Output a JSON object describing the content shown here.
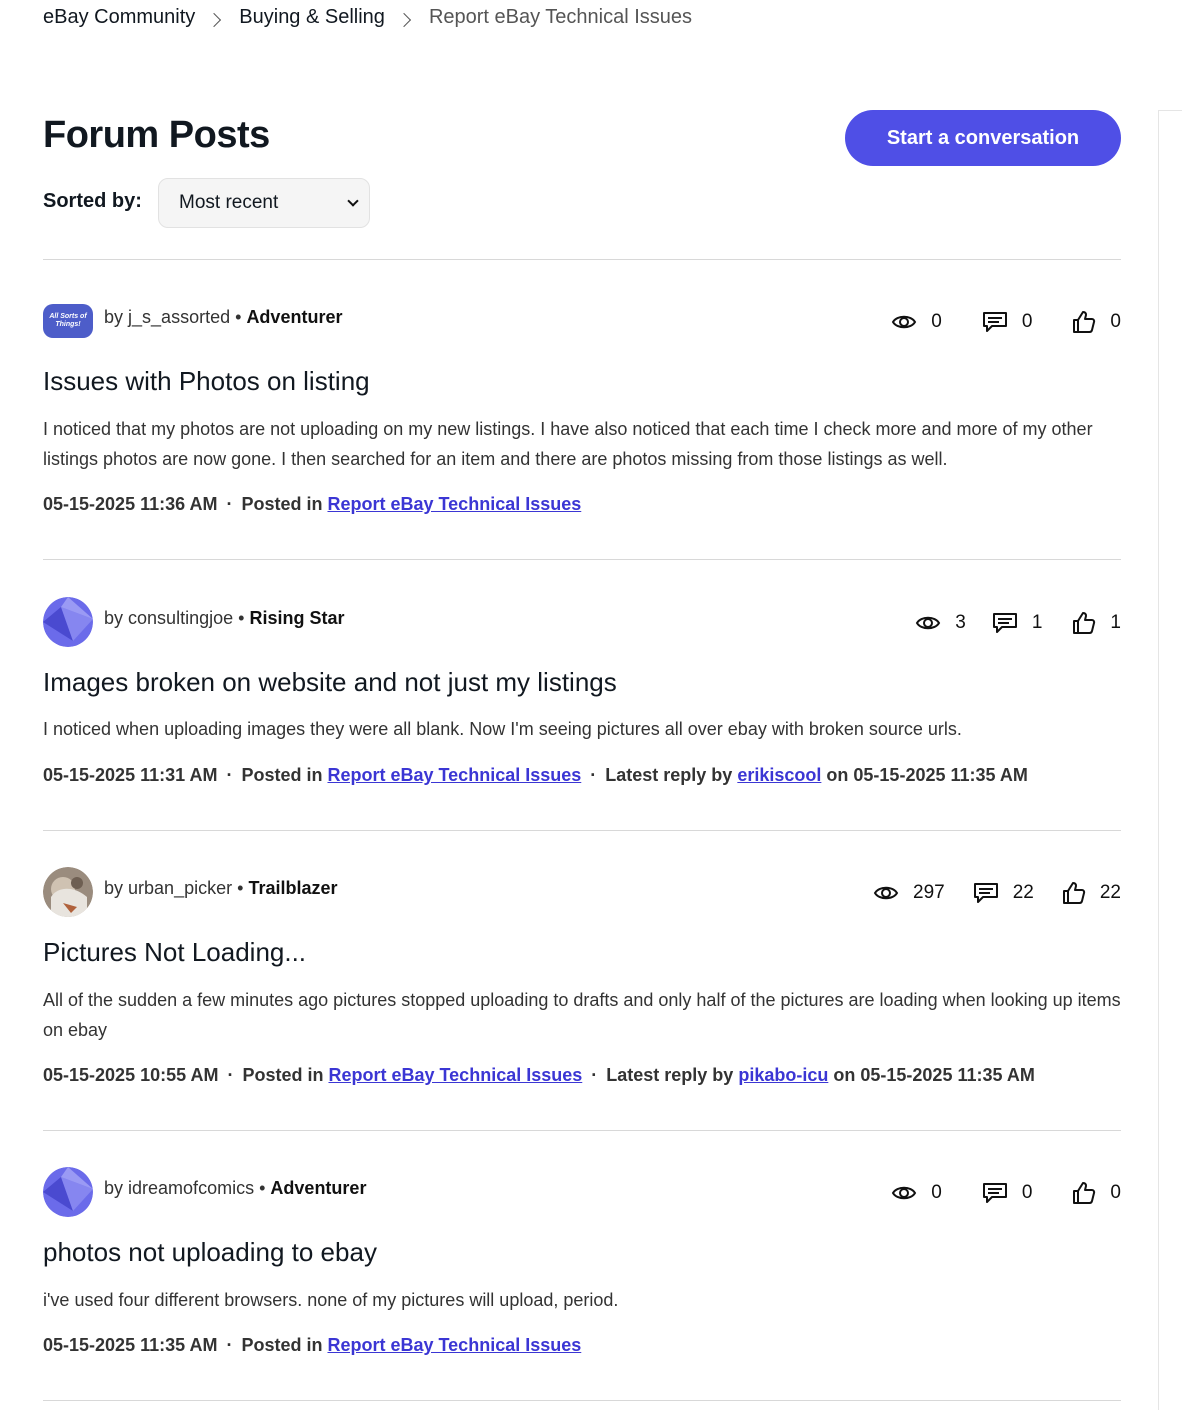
{
  "breadcrumb": [
    "eBay Community",
    "Buying & Selling",
    "Report eBay Technical Issues"
  ],
  "page_title": "Forum Posts",
  "start_button": "Start a conversation",
  "sort": {
    "label": "Sorted by:",
    "value": "Most recent"
  },
  "labels": {
    "by": "by",
    "rank_sep": "•",
    "posted_in": "Posted in",
    "latest_reply_by": "Latest reply by",
    "on": "on"
  },
  "posts": [
    {
      "author": "j_s_assorted",
      "rank": "Adventurer",
      "avatar": "All Sorts of Things!",
      "views": "0",
      "replies": "0",
      "kudos": "0",
      "title": "Issues with Photos on listing",
      "body": "I noticed that my photos are not uploading on my new listings. I have also noticed that each time I check more and more of my other listings photos are now gone. I then searched for an item and there are photos missing from those listings as well.",
      "date": "05-15-2025 11:36 AM",
      "board": "Report eBay Technical Issues"
    },
    {
      "author": "consultingjoe",
      "rank": "Rising Star",
      "views": "3",
      "replies": "1",
      "kudos": "1",
      "title": "Images broken on website and not just my listings",
      "body": "I noticed when uploading images they were all blank. Now I'm seeing pictures all over ebay with broken source urls.",
      "date": "05-15-2025 11:31 AM",
      "board": "Report eBay Technical Issues",
      "latest_reply_user": "erikiscool",
      "latest_reply_date": "05-15-2025 11:35 AM"
    },
    {
      "author": "urban_picker",
      "rank": "Trailblazer",
      "views": "297",
      "replies": "22",
      "kudos": "22",
      "title": "Pictures Not Loading...",
      "body": "All of the sudden a few minutes ago pictures stopped uploading to drafts and only half of the pictures are loading when looking up items on ebay",
      "date": "05-15-2025 10:55 AM",
      "board": "Report eBay Technical Issues",
      "latest_reply_user": "pikabo-icu",
      "latest_reply_date": "05-15-2025 11:35 AM"
    },
    {
      "author": "idreamofcomics",
      "rank": "Adventurer",
      "views": "0",
      "replies": "0",
      "kudos": "0",
      "title": "photos not uploading to ebay",
      "body": "i've used four different browsers. none of my pictures will upload, period.",
      "date": "05-15-2025 11:35 AM",
      "board": "Report eBay Technical Issues"
    }
  ],
  "colors": {
    "accent": "#4f4fe6",
    "link": "#3b36d4",
    "avatar_default": "#6b6bea"
  },
  "icons": [
    "chevron-right-icon",
    "chevron-down-icon",
    "eye-icon",
    "comment-icon",
    "thumbs-up-icon"
  ]
}
